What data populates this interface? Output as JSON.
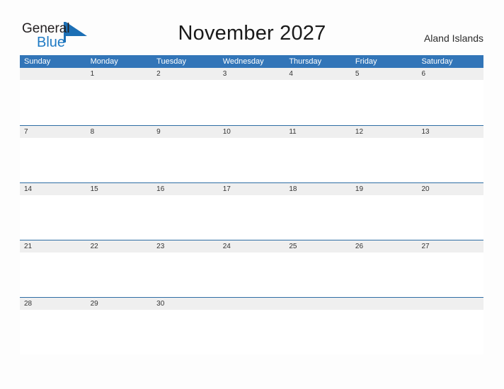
{
  "brand": {
    "name_part1": "General",
    "name_part2": "Blue",
    "color_dark": "#231f20",
    "color_blue": "#1f7ac4"
  },
  "header": {
    "title": "November 2027",
    "locale": "Aland Islands"
  },
  "theme": {
    "header_blue": "#3275b8",
    "row_line_blue": "#2e6da4",
    "band_gray": "#efefef",
    "page_background": "#fdfdfd"
  },
  "calendar": {
    "month": "November",
    "year": "2027",
    "weekday_headers": [
      "Sunday",
      "Monday",
      "Tuesday",
      "Wednesday",
      "Thursday",
      "Friday",
      "Saturday"
    ],
    "weeks": [
      [
        "",
        "1",
        "2",
        "3",
        "4",
        "5",
        "6"
      ],
      [
        "7",
        "8",
        "9",
        "10",
        "11",
        "12",
        "13"
      ],
      [
        "14",
        "15",
        "16",
        "17",
        "18",
        "19",
        "20"
      ],
      [
        "21",
        "22",
        "23",
        "24",
        "25",
        "26",
        "27"
      ],
      [
        "28",
        "29",
        "30",
        "",
        "",
        "",
        ""
      ]
    ]
  }
}
